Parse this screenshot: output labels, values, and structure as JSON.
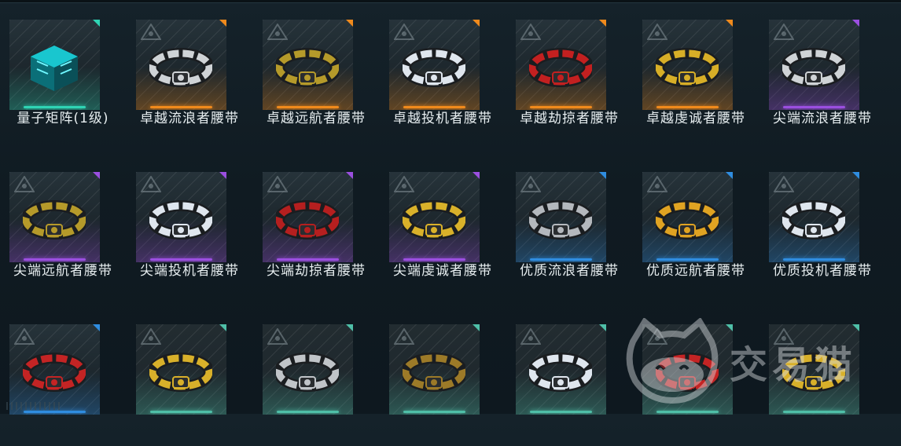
{
  "items": [
    {
      "label": "量子矩阵(1级)",
      "rarity": "teal",
      "icon": "cube-icon"
    },
    {
      "label": "卓越流浪者腰带",
      "rarity": "orange",
      "icon": "belt-icon"
    },
    {
      "label": "卓越远航者腰带",
      "rarity": "orange",
      "icon": "belt-icon"
    },
    {
      "label": "卓越投机者腰带",
      "rarity": "orange",
      "icon": "belt-icon"
    },
    {
      "label": "卓越劫掠者腰带",
      "rarity": "orange",
      "icon": "belt-icon"
    },
    {
      "label": "卓越虔诚者腰带",
      "rarity": "orange",
      "icon": "belt-icon"
    },
    {
      "label": "尖端流浪者腰带",
      "rarity": "purple",
      "icon": "belt-icon"
    },
    {
      "label": "尖端远航者腰带",
      "rarity": "purple",
      "icon": "belt-icon"
    },
    {
      "label": "尖端投机者腰带",
      "rarity": "purple",
      "icon": "belt-icon"
    },
    {
      "label": "尖端劫掠者腰带",
      "rarity": "purple",
      "icon": "belt-icon"
    },
    {
      "label": "尖端虔诚者腰带",
      "rarity": "purple",
      "icon": "belt-icon"
    },
    {
      "label": "优质流浪者腰带",
      "rarity": "blue",
      "icon": "belt-icon"
    },
    {
      "label": "优质远航者腰带",
      "rarity": "blue",
      "icon": "belt-icon"
    },
    {
      "label": "优质投机者腰带",
      "rarity": "blue",
      "icon": "belt-icon"
    },
    {
      "label": "",
      "rarity": "blue",
      "icon": "belt-icon"
    },
    {
      "label": "",
      "rarity": "gray",
      "icon": "belt-icon"
    },
    {
      "label": "",
      "rarity": "gray",
      "icon": "belt-icon"
    },
    {
      "label": "",
      "rarity": "gray",
      "icon": "belt-icon"
    },
    {
      "label": "",
      "rarity": "gray",
      "icon": "belt-icon"
    },
    {
      "label": "",
      "rarity": "gray",
      "icon": "belt-icon"
    },
    {
      "label": "",
      "rarity": "gray",
      "icon": "belt-icon"
    }
  ],
  "rarity_colors": {
    "teal": "#2fd4b4",
    "orange": "#f08a1c",
    "purple": "#9b4fe0",
    "blue": "#2f8de0",
    "gray": "#4fbfa8"
  },
  "watermark": {
    "text": "交易猫",
    "icon": "cat-logo-icon"
  }
}
